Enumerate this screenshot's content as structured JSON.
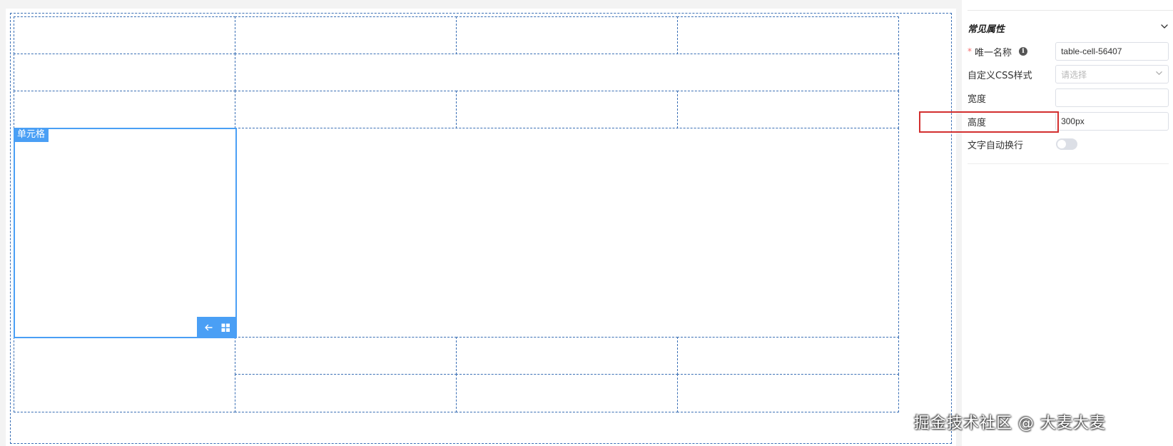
{
  "canvas": {
    "selected_cell_tag": "单元格"
  },
  "panel": {
    "section_title": "常见属性",
    "fields": {
      "unique_name": {
        "required_mark": "*",
        "label": "唯一名称",
        "value": "table-cell-56407"
      },
      "custom_css": {
        "label": "自定义CSS样式",
        "placeholder": "请选择"
      },
      "width": {
        "label": "宽度",
        "value": ""
      },
      "height": {
        "label": "高度",
        "value": "300px"
      },
      "text_wrap": {
        "label": "文字自动换行",
        "enabled": false
      }
    }
  },
  "watermark": "掘金技术社区 @ 大麦大麦",
  "colors": {
    "accent": "#4a9ff5",
    "dashed_border": "#3a6fb5",
    "highlight": "#d32f2f",
    "required": "#f56c6c"
  },
  "icons": {
    "info": "info-circle-icon",
    "collapse": "chevron-down-icon",
    "select_arrow": "chevron-down-icon",
    "tool_back": "arrow-left-icon",
    "tool_grid": "grid-icon"
  }
}
